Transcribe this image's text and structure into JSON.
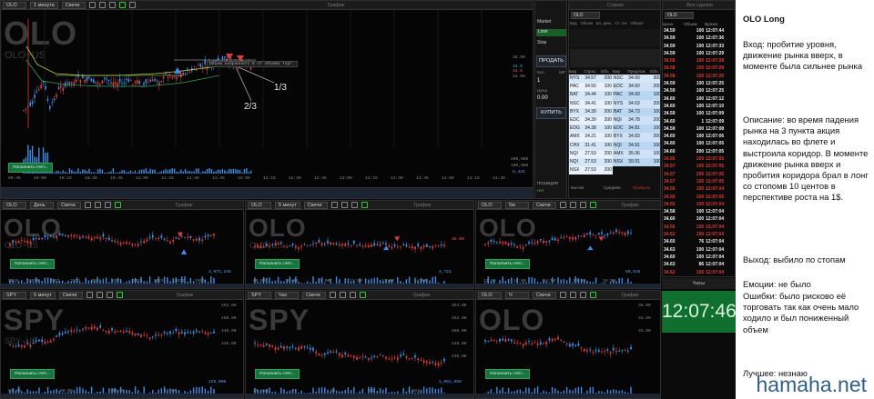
{
  "main_chart": {
    "symbol": "OLO",
    "interval": "1 минута",
    "chart_type": "Свечи",
    "panel_title": "График",
    "watermark": "OLO",
    "watermark_sub": "OLO~US",
    "fill_button": "Пополнить счёт...",
    "annotation_1": "1/3",
    "annotation_2": "2/3",
    "price_ticks": [
      "35.00",
      "34.00"
    ],
    "price_tags": [
      "34.5",
      "34.6"
    ],
    "vol_ticks": [
      "200,000",
      "100,000"
    ],
    "vol_tag": "5,441",
    "order_note": "Объем набранного % от объема торг.",
    "time_ticks": [
      "09:45",
      "10:00",
      "10:15",
      "10:30",
      "10:45",
      "11:00",
      "11:15",
      "11:30",
      "11:45",
      "12:00",
      "12:15",
      "12:30",
      "12:45",
      "13:00",
      "13:15",
      "13:30",
      "13:45",
      "14:00",
      "14:15",
      "14:30"
    ]
  },
  "order_entry": {
    "tabs": [
      "Market",
      "Limit",
      "Stop"
    ],
    "sell": "ПРОДАТЬ",
    "buy": "КУПИТЬ",
    "qty_label": "Кол",
    "qty_value": "1",
    "price_label": "Цена",
    "price_value": "0.00",
    "position_label": "ПОЗИЦИЯ",
    "position_value": "Нет",
    "mp_label": "MP"
  },
  "level2": {
    "title": "Стакан",
    "symbol": "OLO",
    "header": [
      "Бид",
      "Объем",
      "Бл. день",
      "Ст. тек",
      "Оборот"
    ],
    "cols": [
      "Бир",
      "Спрос",
      "Объ",
      "Бир",
      "Предлож",
      "Объ"
    ],
    "rows": [
      {
        "mb": "NYS",
        "b": "34.57",
        "bs": "200",
        "ma": "NSC",
        "a": "34.60",
        "as": "300"
      },
      {
        "mb": "PAC",
        "b": "34.50",
        "bs": "100",
        "ma": "EDC",
        "a": "34.60",
        "as": "200"
      },
      {
        "mb": "BAT",
        "b": "34.44",
        "bs": "100",
        "ma": "PAC",
        "a": "34.60",
        "as": "100"
      },
      {
        "mb": "NSC",
        "b": "34.41",
        "bs": "100",
        "ma": "NYS",
        "a": "34.63",
        "as": "200"
      },
      {
        "mb": "BYX",
        "b": "34.39",
        "bs": "200",
        "ma": "BAT",
        "a": "34.73",
        "as": "100"
      },
      {
        "mb": "EDC",
        "b": "34.39",
        "bs": "200",
        "ma": "NQI",
        "a": "34.78",
        "as": "200"
      },
      {
        "mb": "EDG",
        "b": "34.38",
        "bs": "100",
        "ma": "EDC",
        "a": "34.81",
        "as": "100"
      },
      {
        "mb": "AMX",
        "b": "34.21",
        "bs": "100",
        "ma": "BYX",
        "a": "34.83",
        "as": "200"
      },
      {
        "mb": "CHX",
        "b": "31.41",
        "bs": "100",
        "ma": "NQI",
        "a": "34.91",
        "as": "100"
      },
      {
        "mb": "NQI",
        "b": "27.53",
        "bs": "200",
        "ma": "AMX",
        "a": "35.06",
        "as": "100"
      },
      {
        "mb": "NQI",
        "b": "27.53",
        "bs": "200",
        "ma": "NSX",
        "a": "39.91",
        "as": "100"
      },
      {
        "mb": "NSX",
        "b": "27.53",
        "bs": "200",
        "ma": "",
        "a": "",
        "as": ""
      }
    ],
    "footer_left": "Кол-во",
    "footer_mid": "Средняя",
    "footer_right": "Прибыль"
  },
  "time_sales": {
    "title": "Все сделки",
    "symbol": "OLO",
    "cols": [
      "Цена",
      "Объем",
      "Время"
    ],
    "rows": [
      [
        "34.59",
        "100",
        "12:07:44",
        "w"
      ],
      [
        "34.59",
        "100",
        "12:07:36",
        "w"
      ],
      [
        "34.59",
        "100",
        "12:07:33",
        "w"
      ],
      [
        "34.59",
        "100",
        "12:07:29",
        "w"
      ],
      [
        "34.58",
        "100",
        "12:07:28",
        "r"
      ],
      [
        "34.58",
        "100",
        "12:07:28",
        "r"
      ],
      [
        "34.58",
        "100",
        "12:07:26",
        "r"
      ],
      [
        "34.59",
        "100",
        "12:07:25",
        "w"
      ],
      [
        "34.59",
        "100",
        "12:07:25",
        "w"
      ],
      [
        "34.60",
        "100",
        "12:07:12",
        "w"
      ],
      [
        "34.60",
        "100",
        "12:07:10",
        "w"
      ],
      [
        "34.59",
        "100",
        "12:07:09",
        "w"
      ],
      [
        "34.60",
        "1",
        "12:07:09",
        "w"
      ],
      [
        "34.59",
        "100",
        "12:07:08",
        "w"
      ],
      [
        "34.60",
        "100",
        "12:07:06",
        "w"
      ],
      [
        "34.60",
        "100",
        "12:07:05",
        "w"
      ],
      [
        "34.60",
        "200",
        "12:07:05",
        "w"
      ],
      [
        "34.55",
        "100",
        "12:07:05",
        "r"
      ],
      [
        "34.57",
        "100",
        "12:07:05",
        "r"
      ],
      [
        "34.57",
        "200",
        "12:07:05",
        "r"
      ],
      [
        "34.57",
        "100",
        "12:07:05",
        "r"
      ],
      [
        "34.56",
        "100",
        "12:07:04",
        "r"
      ],
      [
        "34.56",
        "100",
        "12:07:05",
        "r"
      ],
      [
        "34.55",
        "100",
        "12:07:04",
        "r"
      ],
      [
        "34.58",
        "100",
        "12:07:04",
        "w"
      ],
      [
        "34.60",
        "100",
        "12:07:04",
        "w"
      ],
      [
        "34.56",
        "100",
        "12:07:04",
        "r"
      ],
      [
        "34.62",
        "100",
        "12:07:04",
        "r"
      ],
      [
        "34.60",
        "76",
        "12:07:04",
        "w"
      ],
      [
        "34.63",
        "100",
        "12:07:04",
        "w"
      ],
      [
        "34.60",
        "100",
        "12:07:04",
        "w"
      ],
      [
        "34.63",
        "86",
        "12:07:04",
        "w"
      ],
      [
        "34.62",
        "100",
        "12:07:04",
        "r"
      ]
    ],
    "clock_title": "Часы",
    "clock": "12:07:46"
  },
  "mini": [
    {
      "sym": "OLO",
      "interval": "День",
      "type": "Свечи",
      "title": "График",
      "wm": "OLO",
      "sub": "OLO~US",
      "fill": "Пополнить счёт...",
      "vol": "4,071,345",
      "ticks": [
        "2019",
        "2019",
        "2021",
        "2021",
        "2021",
        "2021",
        "2021",
        "2021",
        "2021",
        "2021"
      ]
    },
    {
      "sym": "OLO",
      "interval": "5 минут",
      "type": "Свечи",
      "title": "График",
      "wm": "OLO",
      "sub": "OLO~US",
      "fill": "Пополнить счёт...",
      "vol": "4,721",
      "tag": "35.00",
      "ticks": [
        "09:00",
        "10:00",
        "11:00",
        "12:00",
        "13:00",
        "14:00"
      ]
    },
    {
      "sym": "OLO",
      "interval": "5м",
      "type": "Свечи",
      "title": "График",
      "wm": "OLO",
      "sub": "",
      "fill": "Пополнить счёт...",
      "vol": "69,035",
      "ticks": [
        "12:00",
        "13:00",
        "14:00",
        "15:00",
        "16:00"
      ]
    },
    {
      "sym": "SPY",
      "interval": "5 минут",
      "type": "Свечи",
      "title": "График",
      "wm": "SPY",
      "sub": "SPY~US",
      "fill": "Пополнить счёт...",
      "vol": "225,000",
      "tags": [
        "452.00",
        "450.00",
        "448.00",
        "446.00"
      ],
      "ticks": [
        "07:00",
        "08:00",
        "09:00",
        "10:00"
      ]
    },
    {
      "sym": "SPY",
      "interval": "Час",
      "type": "Свечи",
      "title": "График",
      "wm": "SPY",
      "sub": "",
      "fill": "Пополнить счёт...",
      "vol": "1,051,058",
      "tags": [
        "454.00",
        "452.00",
        "450.00",
        "448.00",
        "446.00"
      ],
      "ticks": [
        "26 Aug",
        "27",
        "30",
        "31",
        "1 Sep"
      ]
    },
    {
      "sym": "OLO",
      "interval": "Ч",
      "type": "Свечи",
      "title": "График",
      "wm": "OLO",
      "sub": "",
      "fill": "Пополнить счёт...",
      "vol": "",
      "tags": [
        "36.00",
        "34.59",
        "33.00"
      ],
      "ticks": []
    }
  ],
  "notes": {
    "title": "OLO Long",
    "entry": "Вход: пробитие уровня, движение рынка вверх, в моменте была сильнее рынка",
    "description": "Описание: во время падения рынка на 3 пункта акция находилась во флете и выстроила коридор. В моменте движение рынка вверх и  пробития коридора брал в лонг со стопомв 10 центов в перспективе роста на 1$.",
    "exit": "Выход: выбило по стопам",
    "emotions": "Емоции: не было",
    "mistakes": "Ошибки: было рисково её торговать так как очень мало ходило и был пониженный объем",
    "best": "Лучшее: незнаю"
  },
  "watermark": "hamaha.net"
}
